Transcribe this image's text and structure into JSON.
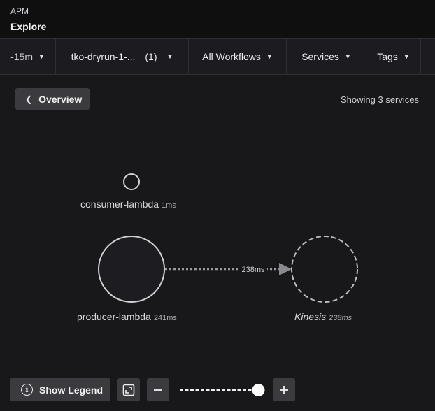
{
  "header": {
    "breadcrumb": "APM",
    "title": "Explore"
  },
  "filters": {
    "time": "-15m",
    "environment": "tko-dryrun-1-...",
    "environment_count": "(1)",
    "workflows": "All Workflows",
    "services": "Services",
    "tags": "Tags"
  },
  "toolbar": {
    "overview_label": "Overview",
    "showing_text": "Showing 3 services"
  },
  "graph": {
    "nodes": [
      {
        "name": "consumer-lambda",
        "latency": "1ms"
      },
      {
        "name": "producer-lambda",
        "latency": "241ms"
      },
      {
        "name": "Kinesis",
        "latency": "238ms",
        "inferred": true
      }
    ],
    "edges": [
      {
        "from": "producer-lambda",
        "to": "Kinesis",
        "latency": "238ms"
      }
    ]
  },
  "controls": {
    "legend_label": "Show Legend",
    "zoom_level": 0.95
  },
  "colors": {
    "background": "#18181b",
    "node_stroke": "#cfcfd4",
    "button": "#3a3a3f"
  }
}
